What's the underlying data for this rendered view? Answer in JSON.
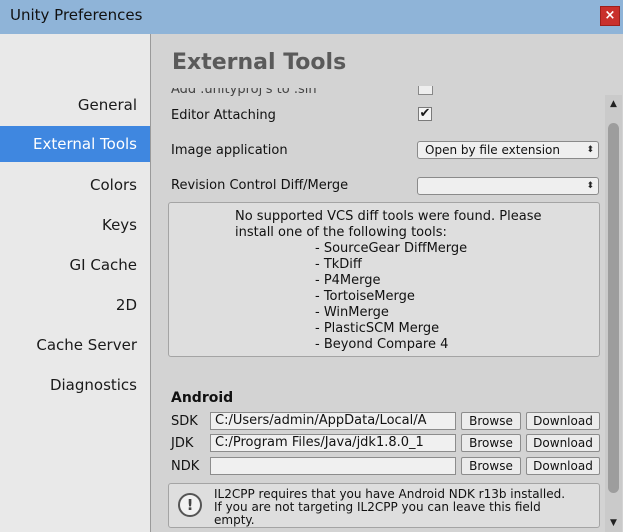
{
  "window": {
    "title": "Unity Preferences",
    "close_label": "×"
  },
  "sidebar": {
    "items": [
      {
        "label": "General",
        "active": false
      },
      {
        "label": "External Tools",
        "active": true
      },
      {
        "label": "Colors",
        "active": false
      },
      {
        "label": "Keys",
        "active": false
      },
      {
        "label": "GI Cache",
        "active": false
      },
      {
        "label": "2D",
        "active": false
      },
      {
        "label": "Cache Server",
        "active": false
      },
      {
        "label": "Diagnostics",
        "active": false
      }
    ]
  },
  "main": {
    "title": "External Tools",
    "cut_row_label": "Add .unityproj's to .sln",
    "editor_attaching": {
      "label": "Editor Attaching",
      "checked": true,
      "check_glyph": "✔"
    },
    "image_application": {
      "label": "Image application",
      "value": "Open by file extension"
    },
    "revision_control": {
      "label": "Revision Control Diff/Merge",
      "value": ""
    },
    "dropdown_arrow": "⬍",
    "vcs_message": "No supported VCS diff tools were found. Please\ninstall one of the following tools:",
    "vcs_tools": [
      "- SourceGear DiffMerge",
      "- TkDiff",
      "- P4Merge",
      "- TortoiseMerge",
      "- WinMerge",
      "- PlasticSCM Merge",
      "- Beyond Compare 4"
    ],
    "android": {
      "title": "Android",
      "rows": [
        {
          "label": "SDK",
          "path": "C:/Users/admin/AppData/Local/A",
          "browse": "Browse",
          "download": "Download"
        },
        {
          "label": "JDK",
          "path": "C:/Program Files/Java/jdk1.8.0_1",
          "browse": "Browse",
          "download": "Download"
        },
        {
          "label": "NDK",
          "path": "",
          "browse": "Browse",
          "download": "Download"
        }
      ]
    },
    "info": {
      "icon": "!",
      "text": "IL2CPP requires that you have Android NDK r13b installed.\nIf you are not targeting IL2CPP you can leave this field\nempty."
    }
  },
  "scrollbar": {
    "up": "▲",
    "down": "▼"
  }
}
